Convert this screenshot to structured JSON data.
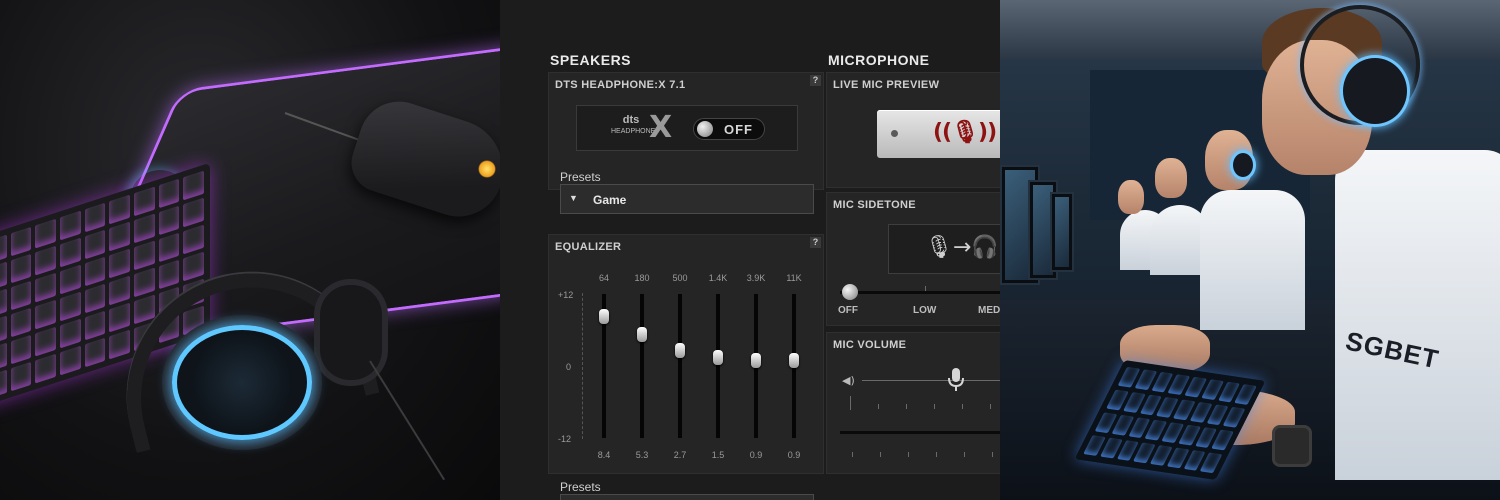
{
  "left_photo": {
    "alt": "gaming-setup-photo"
  },
  "software": {
    "speakers": {
      "title": "SPEAKERS",
      "dts": {
        "label": "DTS HEADPHONE:X 7.1",
        "help": "?",
        "logo_top": "dts",
        "logo_bottom": "HEADPHONE",
        "logo_x": "X",
        "toggle_state": "OFF"
      },
      "presets_label": "Presets",
      "preset_value": "Game",
      "select_arrow": "▼",
      "equalizer": {
        "label": "EQUALIZER",
        "help": "?",
        "db_top": "+12",
        "db_mid": "0",
        "db_bottom": "-12",
        "bands": [
          {
            "freq": "64",
            "value": "8.4",
            "level": 0.85
          },
          {
            "freq": "180",
            "value": "5.3",
            "level": 0.72
          },
          {
            "freq": "500",
            "value": "2.7",
            "level": 0.61
          },
          {
            "freq": "1.4K",
            "value": "1.5",
            "level": 0.56
          },
          {
            "freq": "3.9K",
            "value": "0.9",
            "level": 0.54
          },
          {
            "freq": "11K",
            "value": "0.9",
            "level": 0.54
          }
        ]
      },
      "presets_label_2": "Presets"
    },
    "microphone": {
      "title": "MICROPHONE",
      "live_preview_label": "LIVE MIC PREVIEW",
      "sidetone_label": "MIC SIDETONE",
      "sidetone_ticks": [
        "OFF",
        "LOW",
        "MED"
      ],
      "sidetone_level": 0.0,
      "volume_label": "MIC VOLUME",
      "volume_level": 0.72
    }
  },
  "right_photo": {
    "shirt_text": "SGBET"
  },
  "colors": {
    "pad_glow": "#c46bff",
    "headset_glow": "#5ec8ff",
    "mic_red": "#8e1212"
  },
  "icons": {
    "help": "question-icon",
    "mic_preview": "microphone-waves-icon",
    "sidetone": "mic-to-headphones-icon",
    "volume_low": "speaker-low-icon",
    "volume_thumb": "microphone-icon"
  }
}
